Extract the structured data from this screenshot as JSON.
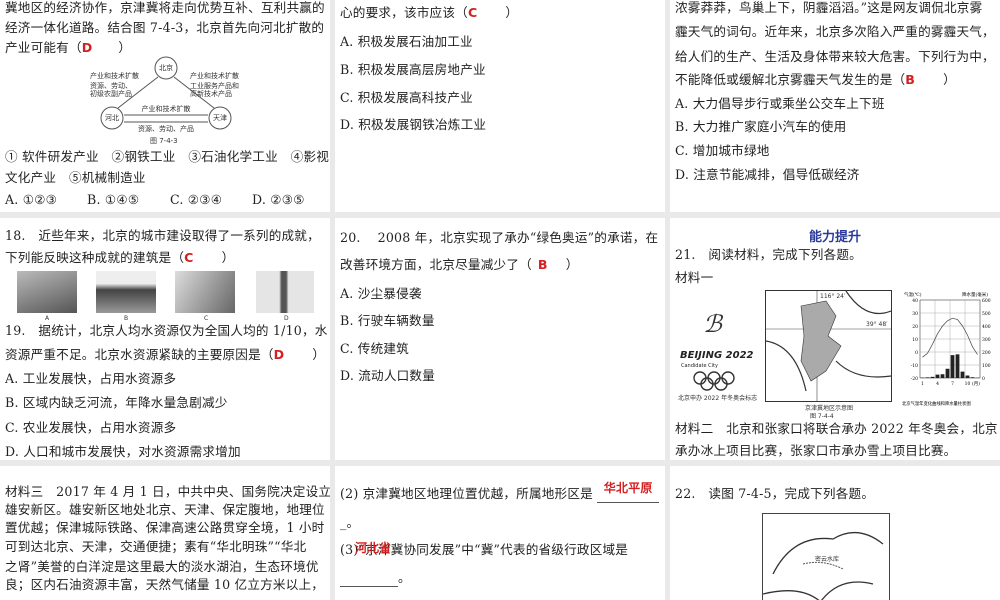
{
  "tl": {
    "lines": [
      "冀地区的经济协作，京津冀将走向优势互补、互利共赢的",
      "经济一体化道路。结合图 7-4-3，北京首先向河北扩散的",
      "产业可能有（"
    ],
    "answer": "D",
    "close": "）",
    "diagram": {
      "beijing": "北京",
      "hebei": "河北",
      "tianjin": "天津",
      "l1": "产业和技术扩散",
      "l2": "资源、劳动、初级农副产品",
      "l3": "产业和技术扩散",
      "l4": "工业服务产品和高新技术产品",
      "l5": "产业和技术扩散",
      "l6": "资源、劳动、产品",
      "caption": "图 7-4-3"
    },
    "opts": [
      "① 软件研发产业　②钢铁工业　③石油化学工业　④影视",
      "文化产业　⑤机械制造业"
    ],
    "choices": [
      "A. ①②③",
      "B. ①④⑤",
      "C. ②③④",
      "D. ②③⑤"
    ]
  },
  "tm": {
    "line": "心的要求，该市应该（",
    "answer": "C",
    "close": "）",
    "opts": [
      "A. 积极发展石油加工业",
      "B. 积极发展高层房地产业",
      "C. 积极发展高科技产业",
      "D. 积极发展钢铁冶炼工业"
    ]
  },
  "tr": {
    "lines": [
      "浓雾莽莽，鸟巢上下，阴霾滔滔。”这是网友调侃北京雾",
      "霾天气的词句。近年来，北京多次陷入严重的雾霾天气，",
      "给人们的生产、生活及身体带来较大危害。下列行为中，",
      "不能降低或缓解北京雾霾天气发生的是（"
    ],
    "answer": "B",
    "close": "）",
    "opts": [
      "A. 大力倡导步行或乘坐公交车上下班",
      "B. 大力推广家庭小汽车的使用",
      "C. 增加城市绿地",
      "D. 注意节能减排，倡导低碳经济"
    ]
  },
  "ml": {
    "q18": [
      "18.　近些年来，北京的城市建设取得了一系列的成就，",
      "下列能反映这种成就的建筑是（"
    ],
    "a18": "C",
    "close": "）",
    "photo_labels": [
      "A",
      "B",
      "C",
      "D"
    ],
    "q19": [
      "19.　据统计，北京人均水资源仅为全国人均的 1/10，水",
      "资源严重不足。北京水资源紧缺的主要原因是（"
    ],
    "a19": "D",
    "opts": [
      "A. 工业发展快，占用水资源多",
      "B. 区域内缺乏河流，年降水量急剧减少",
      "C. 农业发展快，占用水资源多",
      "D. 人口和城市发展快，对水资源需求增加"
    ]
  },
  "mm": {
    "lines": [
      "20.　 2008 年，北京实现了承办“绿色奥运”的承诺，在",
      "改善环境方面，北京尽量减少了（"
    ],
    "answer": "B",
    "close": "）",
    "opts": [
      "A. 沙尘暴侵袭",
      "B. 行驶车辆数量",
      "C. 传统建筑",
      "D. 流动人口数量"
    ]
  },
  "mr": {
    "title": "能力提升",
    "q21": "21.　阅读材料，完成下列各题。",
    "m1": "材料一",
    "logo": "BEIJING 2022",
    "logo_sub": "Candidate City",
    "logo_cap": "北京申办 2022 年冬奥会标志",
    "map_cap": "京津冀地区示意图",
    "fig": "图 7-4-4",
    "map_lon": "116° 24′",
    "map_lat": "39° 48′",
    "chart_cap": "北京气温年变化曲线和降水量柱状图",
    "chart_yl": "气温(℃)",
    "chart_yr": "降水量(毫米)",
    "chart_x": [
      "1",
      "4",
      "7",
      "10",
      "(月)"
    ],
    "chart_data": {
      "type": "bar",
      "temp": [
        -4,
        -1,
        6,
        14,
        20,
        24,
        26,
        25,
        20,
        13,
        4,
        -2
      ],
      "precip": [
        3,
        5,
        9,
        26,
        29,
        71,
        176,
        182,
        49,
        19,
        6,
        2
      ],
      "ylim_temp": [
        -20,
        40
      ],
      "ylim_precip": [
        0,
        600
      ],
      "yticks_temp": [
        "40",
        "30",
        "20",
        "10",
        "0",
        "-10",
        "-20"
      ],
      "yticks_precip": [
        "600",
        "500",
        "400",
        "300",
        "200",
        "100",
        "0"
      ]
    },
    "m2": [
      "材料二　北京和张家口将联合承办 2022 年冬奥会，北京",
      "承办冰上项目比赛，张家口市承办雪上项目比赛。"
    ]
  },
  "bl": {
    "lines": [
      "材料三　2017 年 4 月 1 日，中共中央、国务院决定设立",
      "雄安新区。雄安新区地处北京、天津、保定腹地，地理位",
      "置优越；保津城际铁路、保津高速公路贯穿全境，1 小时",
      "可到达北京、天津，交通便捷；素有“华北明珠”“华北",
      "之肾”美誉的白洋淀是这里最大的淡水湖泊，生态环境优",
      "良；区内石油资源丰富，天然气储量 10 亿立方米以上，"
    ]
  },
  "bm": {
    "q2": "(2) 京津冀地区地理位置优越，所属地形区是",
    "a2": "华北平原",
    "end": "_。",
    "q3": "(3)“京津冀协同发展”中“冀”代表的省级行政区域是",
    "a3": "河北省",
    "end3": "。"
  },
  "br": {
    "q22": "22.　读图 7-4-5，完成下列各题。",
    "map_label": "密云水库"
  }
}
